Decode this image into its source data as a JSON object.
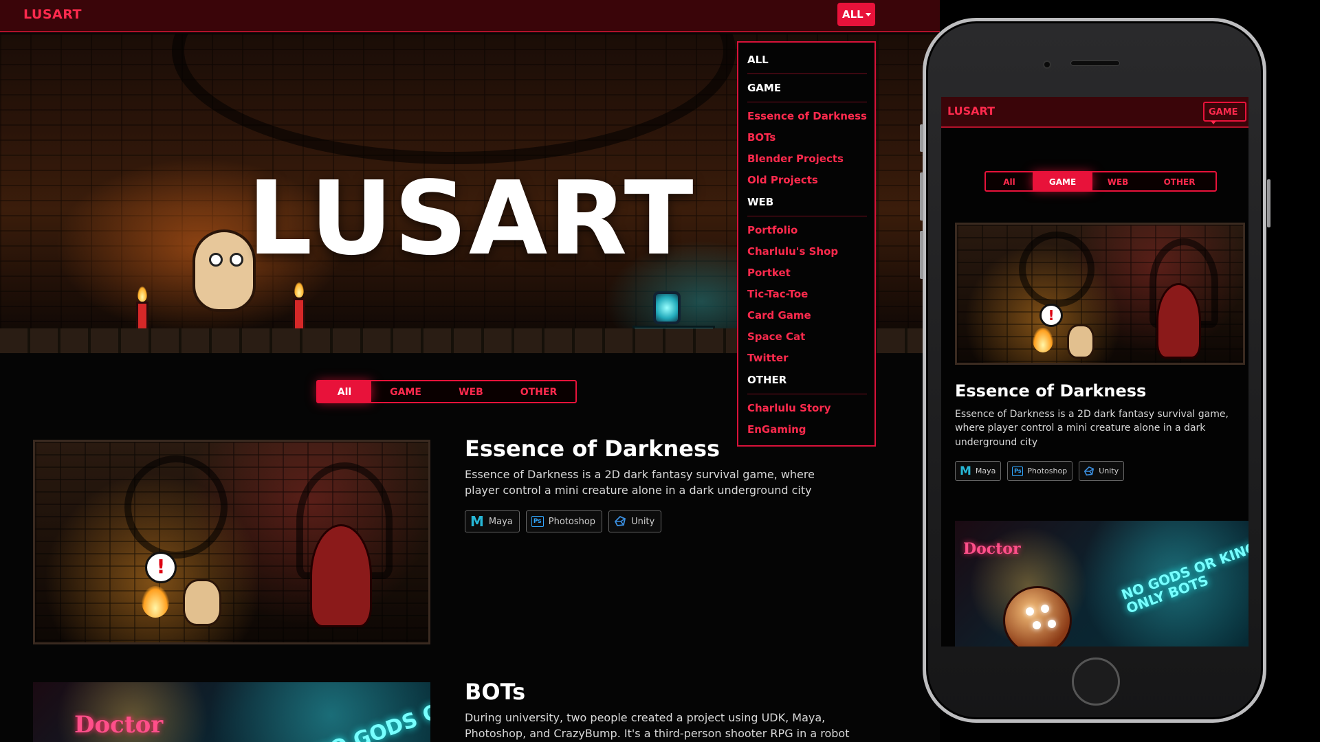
{
  "site": {
    "brand": "LUSART",
    "hero_title": "LUSART",
    "nav_dropdown_label": "ALL",
    "colors": {
      "accent": "#e8123a",
      "navbar": "#3a0509",
      "background": "#050505",
      "link": "#ff2a4d"
    }
  },
  "filter_tabs": [
    {
      "label": "All",
      "active": true
    },
    {
      "label": "GAME",
      "active": false
    },
    {
      "label": "WEB",
      "active": false
    },
    {
      "label": "OTHER",
      "active": false
    }
  ],
  "dropdown": {
    "all": "ALL",
    "game": "GAME",
    "game_items": [
      "Essence of Darkness",
      "BOTs",
      "Blender Projects",
      "Old Projects"
    ],
    "web": "WEB",
    "web_items": [
      "Portfolio",
      "Charlulu's Shop",
      "Portket",
      "Tic-Tac-Toe",
      "Card Game",
      "Space Cat",
      "Twitter"
    ],
    "other": "OTHER",
    "other_items": [
      "Charlulu Story",
      "EnGaming"
    ]
  },
  "projects": [
    {
      "title": "Essence of Darkness",
      "description": "Essence of Darkness is a 2D dark fantasy survival game, where player control a mini creature alone in a dark underground city",
      "tags": [
        {
          "label": "Maya",
          "icon": "maya-icon"
        },
        {
          "label": "Photoshop",
          "icon": "photoshop-icon"
        },
        {
          "label": "Unity",
          "icon": "unity-icon"
        }
      ]
    },
    {
      "title": "BOTs",
      "description": "During university, two people created a project using UDK, Maya, Photoshop, and CrazyBump. It's a third-person shooter RPG in a robot"
    }
  ],
  "images": {
    "bots_neon": "Doctor",
    "bots_sign_line1": "NO GODS OR KINGS",
    "bots_sign_line2": "ONLY BOTS",
    "eod_alert": "!",
    "photoshop_icon_text": "Ps",
    "maya_icon_text": "M"
  },
  "mobile": {
    "brand": "LUSART",
    "nav_dropdown_label": "GAME",
    "filter_tabs": [
      {
        "label": "All",
        "active": false
      },
      {
        "label": "GAME",
        "active": true
      },
      {
        "label": "WEB",
        "active": false
      },
      {
        "label": "OTHER",
        "active": false
      }
    ]
  }
}
